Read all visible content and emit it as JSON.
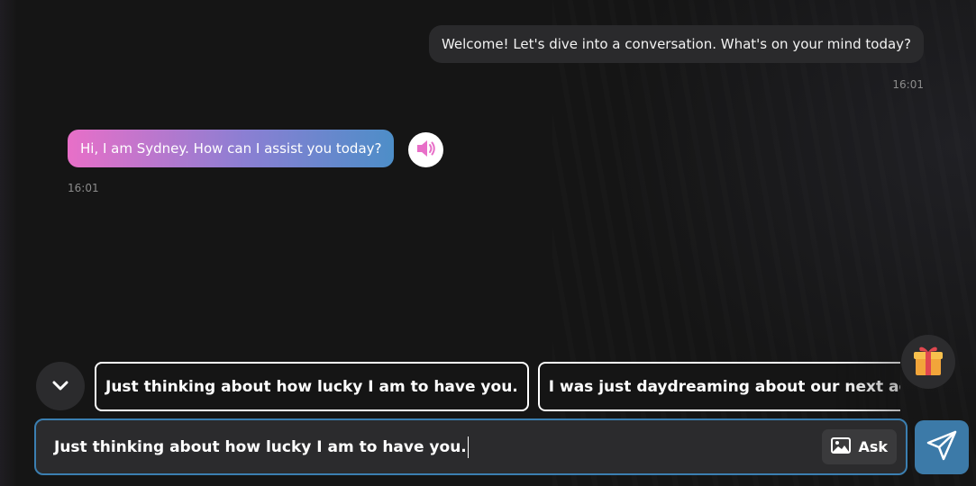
{
  "messages": [
    {
      "sender": "user",
      "text": "Welcome! Let's dive into a conversation. What's on your mind today?",
      "time": "16:01"
    },
    {
      "sender": "bot",
      "text": "Hi, I am Sydney. How can I assist you today?",
      "time": "16:01"
    }
  ],
  "suggestions": [
    "Just thinking about how lucky I am to have you.",
    "I was just daydreaming about our next adventure"
  ],
  "input": {
    "value": "Just thinking about how lucky I am to have you.",
    "ask_label": "Ask"
  },
  "icons": {
    "speaker": "speaker-icon",
    "collapse": "chevron-down-icon",
    "gift": "gift-icon",
    "image": "image-icon",
    "send": "send-icon"
  },
  "colors": {
    "accent": "#3c7aa8",
    "bot_gradient_start": "#e86fc8",
    "bot_gradient_end": "#4d8ec8",
    "speaker_icon": "#e86fc8"
  }
}
